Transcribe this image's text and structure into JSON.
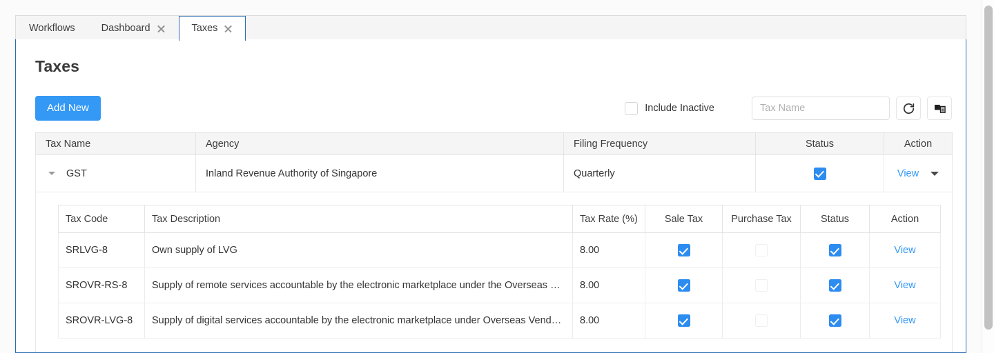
{
  "tabs": [
    {
      "label": "Workflows",
      "closable": false,
      "active": false
    },
    {
      "label": "Dashboard",
      "closable": true,
      "active": false
    },
    {
      "label": "Taxes",
      "closable": true,
      "active": true
    }
  ],
  "page": {
    "title": "Taxes"
  },
  "toolbar": {
    "add_new_label": "Add New",
    "include_inactive_label": "Include Inactive",
    "include_inactive_checked": false,
    "search_placeholder": "Tax Name",
    "search_value": "",
    "refresh_icon": "refresh-icon",
    "columns_icon": "columns-icon"
  },
  "table": {
    "columns": [
      "Tax Name",
      "Agency",
      "Filing Frequency",
      "Status",
      "Action"
    ],
    "rows": [
      {
        "expanded": true,
        "tax_name": "GST",
        "agency": "Inland Revenue Authority of Singapore",
        "filing_frequency": "Quarterly",
        "status_checked": true,
        "action_label": "View"
      }
    ]
  },
  "detail_table": {
    "columns": [
      "Tax Code",
      "Tax Description",
      "Tax Rate (%)",
      "Sale Tax",
      "Purchase Tax",
      "Status",
      "Action"
    ],
    "rows": [
      {
        "tax_code": "SRLVG-8",
        "tax_description": "Own supply of LVG",
        "tax_rate": "8.00",
        "sale_tax_checked": true,
        "purchase_tax_checked": false,
        "status_checked": true,
        "action_label": "View"
      },
      {
        "tax_code": "SROVR-RS-8",
        "tax_description": "Supply of remote services accountable by the electronic marketplace under the Overseas Vend…",
        "tax_rate": "8.00",
        "sale_tax_checked": true,
        "purchase_tax_checked": false,
        "status_checked": true,
        "action_label": "View"
      },
      {
        "tax_code": "SROVR-LVG-8",
        "tax_description": "Supply of digital services accountable by the electronic marketplace under Overseas Vendor R…",
        "tax_rate": "8.00",
        "sale_tax_checked": true,
        "purchase_tax_checked": false,
        "status_checked": true,
        "action_label": "View"
      }
    ]
  },
  "colors": {
    "accent_blue": "#3498f5",
    "checkbox_blue": "#2d8cf0",
    "panel_border": "#2b6cb0",
    "header_bg": "#f5f5f5"
  }
}
